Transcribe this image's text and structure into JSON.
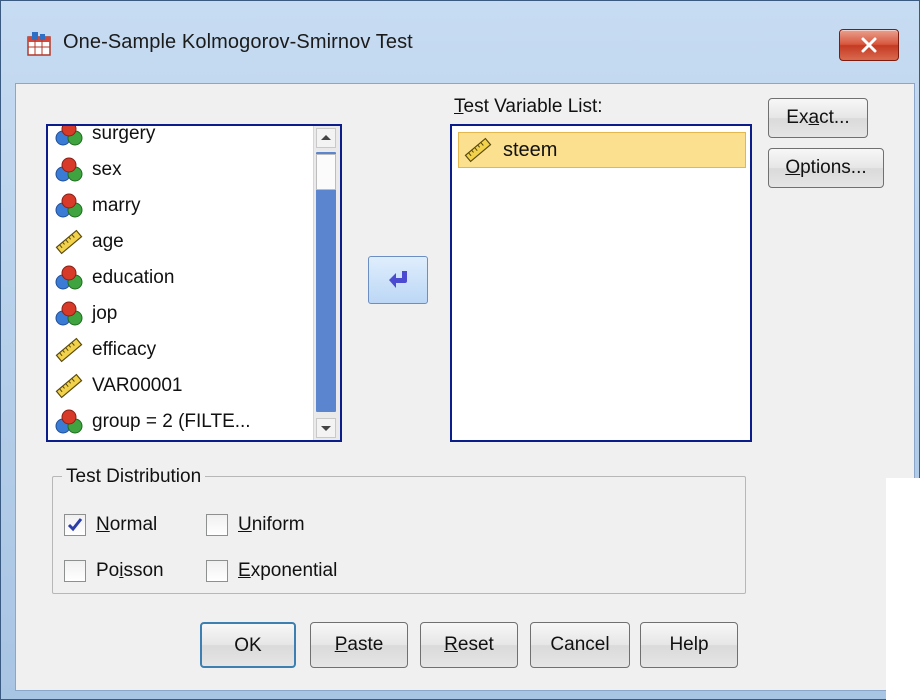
{
  "window": {
    "title": "One-Sample Kolmogorov-Smirnov Test",
    "close_icon": "close-x-icon"
  },
  "source_list": {
    "items": [
      {
        "label": "surgery",
        "icon": "nominal-variable-icon"
      },
      {
        "label": "sex",
        "icon": "nominal-variable-icon"
      },
      {
        "label": "marry",
        "icon": "nominal-variable-icon"
      },
      {
        "label": "age",
        "icon": "scale-variable-icon"
      },
      {
        "label": "education",
        "icon": "nominal-variable-icon"
      },
      {
        "label": "jop",
        "icon": "nominal-variable-icon"
      },
      {
        "label": "efficacy",
        "icon": "scale-variable-icon"
      },
      {
        "label": "VAR00001",
        "icon": "scale-variable-icon"
      },
      {
        "label": "group = 2 (FILTE...",
        "icon": "nominal-variable-icon"
      }
    ]
  },
  "move_button": {
    "icon": "move-arrow-icon"
  },
  "target_list": {
    "label_prefix": "T",
    "label_rest": "est Variable List:",
    "items": [
      {
        "label": "steem",
        "icon": "scale-variable-icon",
        "selected": true
      }
    ]
  },
  "side_buttons": {
    "exact_pre": "Ex",
    "exact_u": "a",
    "exact_post": "ct...",
    "options_u": "O",
    "options_post": "ptions..."
  },
  "test_distribution": {
    "legend": "Test Distribution",
    "options": [
      {
        "pre": "",
        "u": "N",
        "post": "ormal",
        "checked": true
      },
      {
        "pre": "",
        "u": "U",
        "post": "niform",
        "checked": false
      },
      {
        "pre": "Po",
        "u": "i",
        "post": "sson",
        "checked": false
      },
      {
        "pre": "",
        "u": "E",
        "post": "xponential",
        "checked": false
      }
    ]
  },
  "bottom_buttons": {
    "ok": "OK",
    "paste_u": "P",
    "paste_post": "aste",
    "reset_u": "R",
    "reset_post": "eset",
    "cancel": "Cancel",
    "help": "Help"
  },
  "colors": {
    "selection": "#fbe08f",
    "list_border": "#0a1d8a",
    "close_button": "#c43a22"
  }
}
